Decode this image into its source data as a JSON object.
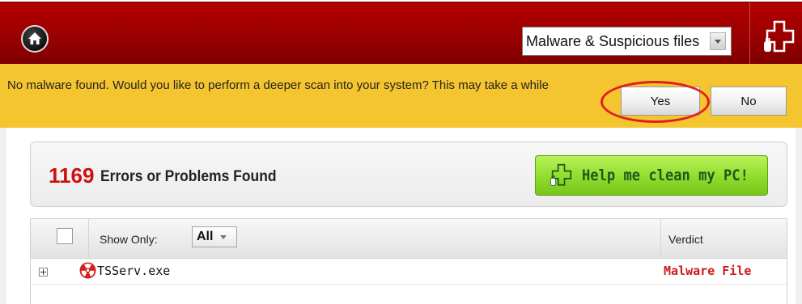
{
  "header": {
    "home_icon": "home-icon",
    "filter_select": {
      "value": "Malware & Suspicious files",
      "icon": "chevron-down-icon"
    },
    "brand_icon": "medical-cross-plug-icon"
  },
  "notification": {
    "text": "No malware found. Would you like to perform a deeper scan into your system? This may take a while",
    "yes_label": "Yes",
    "no_label": "No",
    "highlight_color": "#e02020"
  },
  "results": {
    "count": "1169",
    "label": "Errors or Problems Found",
    "clean_button_label": "Help me clean my PC!",
    "clean_button_icon": "medical-cross-plug-icon"
  },
  "table": {
    "headers": {
      "show_only": "Show Only:",
      "filter_value": "All",
      "verdict": "Verdict"
    },
    "rows": [
      {
        "name": "TSServ.exe",
        "verdict": "Malware File",
        "icon": "radiation-icon"
      }
    ]
  },
  "colors": {
    "header_red": "#9a0000",
    "notification_yellow": "#f5c530",
    "error_red": "#cc1010",
    "clean_green": "#8fdc2c"
  }
}
